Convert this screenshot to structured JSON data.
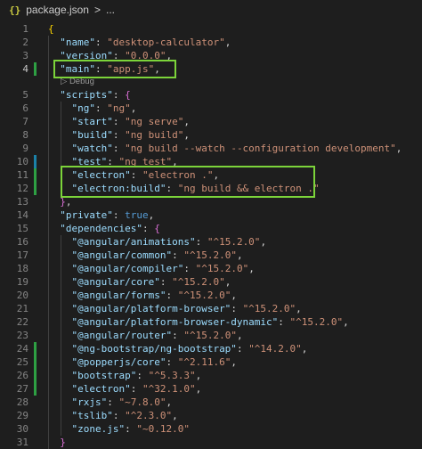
{
  "breadcrumb": {
    "icon": "{}",
    "file": "package.json",
    "separator": ">",
    "more": "..."
  },
  "codelens": "Debug",
  "highlight_color": "#7cd43a",
  "gutter_modified_color": "#2ea043",
  "gutter_changed_color": "#1b81a8",
  "lines": [
    {
      "n": "1",
      "tokens": [
        {
          "t": "{",
          "c": "br1"
        }
      ]
    },
    {
      "n": "2",
      "tokens": [
        {
          "t": "  "
        },
        {
          "t": "\"name\"",
          "c": "k"
        },
        {
          "t": ": "
        },
        {
          "t": "\"desktop-calculator\"",
          "c": "s"
        },
        {
          "t": ","
        }
      ]
    },
    {
      "n": "3",
      "tokens": [
        {
          "t": "  "
        },
        {
          "t": "\"version\"",
          "c": "k"
        },
        {
          "t": ": "
        },
        {
          "t": "\"0.0.0\"",
          "c": "s"
        },
        {
          "t": ","
        }
      ]
    },
    {
      "n": "4",
      "tokens": [
        {
          "t": "  "
        },
        {
          "t": "\"main\"",
          "c": "k"
        },
        {
          "t": ": "
        },
        {
          "t": "\"app.js\"",
          "c": "s"
        },
        {
          "t": ","
        }
      ]
    },
    {
      "n": "5",
      "tokens": [
        {
          "t": "  "
        },
        {
          "t": "\"scripts\"",
          "c": "k"
        },
        {
          "t": ": "
        },
        {
          "t": "{",
          "c": "br2"
        }
      ]
    },
    {
      "n": "6",
      "tokens": [
        {
          "t": "    "
        },
        {
          "t": "\"ng\"",
          "c": "k"
        },
        {
          "t": ": "
        },
        {
          "t": "\"ng\"",
          "c": "s"
        },
        {
          "t": ","
        }
      ]
    },
    {
      "n": "7",
      "tokens": [
        {
          "t": "    "
        },
        {
          "t": "\"start\"",
          "c": "k"
        },
        {
          "t": ": "
        },
        {
          "t": "\"ng serve\"",
          "c": "s"
        },
        {
          "t": ","
        }
      ]
    },
    {
      "n": "8",
      "tokens": [
        {
          "t": "    "
        },
        {
          "t": "\"build\"",
          "c": "k"
        },
        {
          "t": ": "
        },
        {
          "t": "\"ng build\"",
          "c": "s"
        },
        {
          "t": ","
        }
      ]
    },
    {
      "n": "9",
      "tokens": [
        {
          "t": "    "
        },
        {
          "t": "\"watch\"",
          "c": "k"
        },
        {
          "t": ": "
        },
        {
          "t": "\"ng build --watch --configuration development\"",
          "c": "s"
        },
        {
          "t": ","
        }
      ]
    },
    {
      "n": "10",
      "tokens": [
        {
          "t": "    "
        },
        {
          "t": "\"test\"",
          "c": "k"
        },
        {
          "t": ": "
        },
        {
          "t": "\"ng test\"",
          "c": "s"
        },
        {
          "t": ","
        }
      ]
    },
    {
      "n": "11",
      "tokens": [
        {
          "t": "    "
        },
        {
          "t": "\"electron\"",
          "c": "k"
        },
        {
          "t": ": "
        },
        {
          "t": "\"electron .\"",
          "c": "s"
        },
        {
          "t": ","
        }
      ]
    },
    {
      "n": "12",
      "tokens": [
        {
          "t": "    "
        },
        {
          "t": "\"electron:build\"",
          "c": "k"
        },
        {
          "t": ": "
        },
        {
          "t": "\"ng build && electron .\"",
          "c": "s"
        }
      ]
    },
    {
      "n": "13",
      "tokens": [
        {
          "t": "  "
        },
        {
          "t": "}",
          "c": "br2"
        },
        {
          "t": ","
        }
      ]
    },
    {
      "n": "14",
      "tokens": [
        {
          "t": "  "
        },
        {
          "t": "\"private\"",
          "c": "k"
        },
        {
          "t": ": "
        },
        {
          "t": "true",
          "c": "b"
        },
        {
          "t": ","
        }
      ]
    },
    {
      "n": "15",
      "tokens": [
        {
          "t": "  "
        },
        {
          "t": "\"dependencies\"",
          "c": "k"
        },
        {
          "t": ": "
        },
        {
          "t": "{",
          "c": "br2"
        }
      ]
    },
    {
      "n": "16",
      "tokens": [
        {
          "t": "    "
        },
        {
          "t": "\"@angular/animations\"",
          "c": "k"
        },
        {
          "t": ": "
        },
        {
          "t": "\"^15.2.0\"",
          "c": "s"
        },
        {
          "t": ","
        }
      ]
    },
    {
      "n": "17",
      "tokens": [
        {
          "t": "    "
        },
        {
          "t": "\"@angular/common\"",
          "c": "k"
        },
        {
          "t": ": "
        },
        {
          "t": "\"^15.2.0\"",
          "c": "s"
        },
        {
          "t": ","
        }
      ]
    },
    {
      "n": "18",
      "tokens": [
        {
          "t": "    "
        },
        {
          "t": "\"@angular/compiler\"",
          "c": "k"
        },
        {
          "t": ": "
        },
        {
          "t": "\"^15.2.0\"",
          "c": "s"
        },
        {
          "t": ","
        }
      ]
    },
    {
      "n": "19",
      "tokens": [
        {
          "t": "    "
        },
        {
          "t": "\"@angular/core\"",
          "c": "k"
        },
        {
          "t": ": "
        },
        {
          "t": "\"^15.2.0\"",
          "c": "s"
        },
        {
          "t": ","
        }
      ]
    },
    {
      "n": "20",
      "tokens": [
        {
          "t": "    "
        },
        {
          "t": "\"@angular/forms\"",
          "c": "k"
        },
        {
          "t": ": "
        },
        {
          "t": "\"^15.2.0\"",
          "c": "s"
        },
        {
          "t": ","
        }
      ]
    },
    {
      "n": "21",
      "tokens": [
        {
          "t": "    "
        },
        {
          "t": "\"@angular/platform-browser\"",
          "c": "k"
        },
        {
          "t": ": "
        },
        {
          "t": "\"^15.2.0\"",
          "c": "s"
        },
        {
          "t": ","
        }
      ]
    },
    {
      "n": "22",
      "tokens": [
        {
          "t": "    "
        },
        {
          "t": "\"@angular/platform-browser-dynamic\"",
          "c": "k"
        },
        {
          "t": ": "
        },
        {
          "t": "\"^15.2.0\"",
          "c": "s"
        },
        {
          "t": ","
        }
      ]
    },
    {
      "n": "23",
      "tokens": [
        {
          "t": "    "
        },
        {
          "t": "\"@angular/router\"",
          "c": "k"
        },
        {
          "t": ": "
        },
        {
          "t": "\"^15.2.0\"",
          "c": "s"
        },
        {
          "t": ","
        }
      ]
    },
    {
      "n": "24",
      "tokens": [
        {
          "t": "    "
        },
        {
          "t": "\"@ng-bootstrap/ng-bootstrap\"",
          "c": "k"
        },
        {
          "t": ": "
        },
        {
          "t": "\"^14.2.0\"",
          "c": "s"
        },
        {
          "t": ","
        }
      ]
    },
    {
      "n": "25",
      "tokens": [
        {
          "t": "    "
        },
        {
          "t": "\"@popperjs/core\"",
          "c": "k"
        },
        {
          "t": ": "
        },
        {
          "t": "\"^2.11.6\"",
          "c": "s"
        },
        {
          "t": ","
        }
      ]
    },
    {
      "n": "26",
      "tokens": [
        {
          "t": "    "
        },
        {
          "t": "\"bootstrap\"",
          "c": "k"
        },
        {
          "t": ": "
        },
        {
          "t": "\"^5.3.3\"",
          "c": "s"
        },
        {
          "t": ","
        }
      ]
    },
    {
      "n": "27",
      "tokens": [
        {
          "t": "    "
        },
        {
          "t": "\"electron\"",
          "c": "k"
        },
        {
          "t": ": "
        },
        {
          "t": "\"^32.1.0\"",
          "c": "s"
        },
        {
          "t": ","
        }
      ]
    },
    {
      "n": "28",
      "tokens": [
        {
          "t": "    "
        },
        {
          "t": "\"rxjs\"",
          "c": "k"
        },
        {
          "t": ": "
        },
        {
          "t": "\"~7.8.0\"",
          "c": "s"
        },
        {
          "t": ","
        }
      ]
    },
    {
      "n": "29",
      "tokens": [
        {
          "t": "    "
        },
        {
          "t": "\"tslib\"",
          "c": "k"
        },
        {
          "t": ": "
        },
        {
          "t": "\"^2.3.0\"",
          "c": "s"
        },
        {
          "t": ","
        }
      ]
    },
    {
      "n": "30",
      "tokens": [
        {
          "t": "    "
        },
        {
          "t": "\"zone.js\"",
          "c": "k"
        },
        {
          "t": ": "
        },
        {
          "t": "\"~0.12.0\"",
          "c": "s"
        }
      ]
    },
    {
      "n": "31",
      "tokens": [
        {
          "t": "  "
        },
        {
          "t": "}",
          "c": "br2"
        }
      ]
    }
  ]
}
